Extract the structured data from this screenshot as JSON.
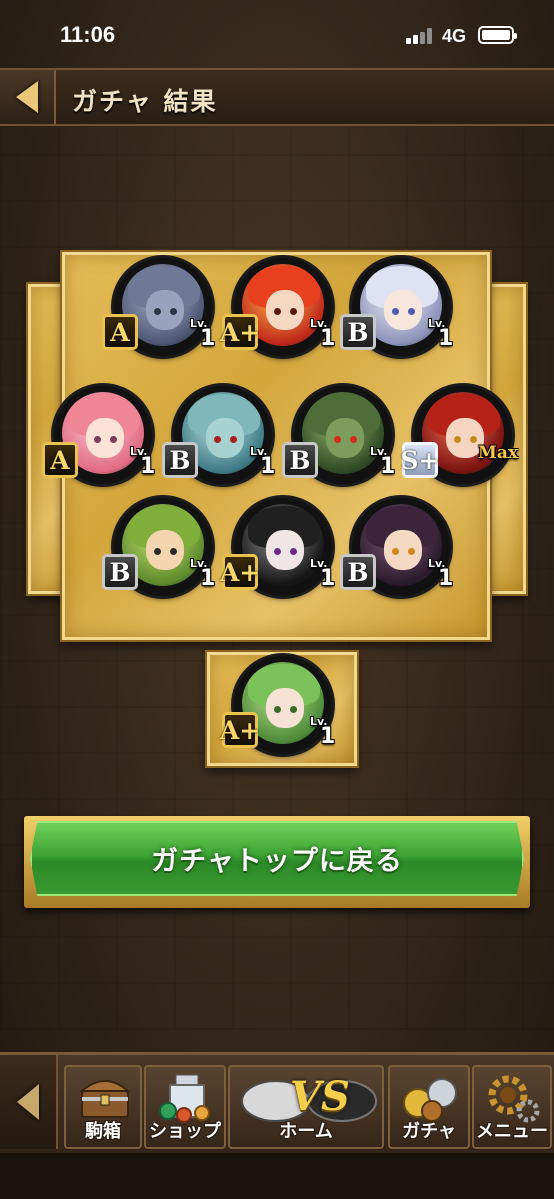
{
  "status_bar": {
    "time": "11:06",
    "network": "4G"
  },
  "header": {
    "title": "ガチャ 結果"
  },
  "results": [
    {
      "rank": "A",
      "rank_style": "gold",
      "lv_label": "Lv.",
      "level": "1",
      "c1": "#a7b0c8",
      "c2": "#4c5572",
      "hair": "#6f7894",
      "face": "#9aa3bd",
      "eye": "#2e3448",
      "ring": "#9b36d8"
    },
    {
      "rank": "A+",
      "rank_style": "gold",
      "lv_label": "Lv.",
      "level": "1",
      "c1": "#ffb14a",
      "c2": "#c0281a",
      "hair": "#e8401f",
      "face": "#f6d8c2",
      "eye": "#5a1a10",
      "ring": "#9b36d8"
    },
    {
      "rank": "B",
      "rank_style": "silver",
      "lv_label": "Lv.",
      "level": "1",
      "c1": "#f0f2fb",
      "c2": "#8b91b8",
      "hair": "#dfe2f2",
      "face": "#f7e6dc",
      "eye": "#4a5bb0",
      "ring": "#e8d02a"
    },
    {
      "rank": "A",
      "rank_style": "gold",
      "lv_label": "Lv.",
      "level": "1",
      "c1": "#ffc2d1",
      "c2": "#e06b82",
      "hair": "#f08596",
      "face": "#fbe1d6",
      "eye": "#7a3d58",
      "ring": "#e8d02a"
    },
    {
      "rank": "B",
      "rank_style": "silver",
      "lv_label": "Lv.",
      "level": "1",
      "c1": "#b9e0e0",
      "c2": "#3e7a86",
      "hair": "#7fb7bb",
      "face": "#a6d3d2",
      "eye": "#a82020",
      "ring": "#9b36d8"
    },
    {
      "rank": "B",
      "rank_style": "silver",
      "lv_label": "Lv.",
      "level": "1",
      "c1": "#8fb26b",
      "c2": "#2f4a24",
      "hair": "#4f6d38",
      "face": "#7c9d5b",
      "eye": "#d62b1c",
      "ring": "#d62b2b"
    },
    {
      "rank": "S+",
      "rank_style": "splus",
      "lv_label": "",
      "level": "Max",
      "c1": "#f06a55",
      "c2": "#7a1310",
      "hair": "#b72218",
      "face": "#f5d5c1",
      "eye": "#c48a1c",
      "ring": "#f0c23a"
    },
    {
      "rank": "B",
      "rank_style": "silver",
      "lv_label": "Lv.",
      "level": "1",
      "c1": "#c6e26f",
      "c2": "#5d8a2c",
      "hair": "#7fae3a",
      "face": "#f3d6b0",
      "eye": "#2a2a2a",
      "ring": "#e8d02a"
    },
    {
      "rank": "A+",
      "rank_style": "gold",
      "lv_label": "Lv.",
      "level": "1",
      "c1": "#8e8e8e",
      "c2": "#161616",
      "hair": "#202020",
      "face": "#f1e6e6",
      "eye": "#6c2c8a",
      "ring": "#9b36d8"
    },
    {
      "rank": "B",
      "rank_style": "silver",
      "lv_label": "Lv.",
      "level": "1",
      "c1": "#7d5a7a",
      "c2": "#2b1a2b",
      "hair": "#3c243b",
      "face": "#f4d9c4",
      "eye": "#d28a1c",
      "ring": "#9b36d8"
    }
  ],
  "bonus": {
    "rank": "A+",
    "rank_style": "gold",
    "lv_label": "Lv.",
    "level": "1",
    "c1": "#b6e28a",
    "c2": "#4e8a3a",
    "hair": "#7cc25a",
    "face": "#f6e3d6",
    "eye": "#3e6a2c",
    "ring": "#9b36d8"
  },
  "return_button": {
    "label": "ガチャトップに戻る"
  },
  "nav": {
    "box": "駒箱",
    "shop": "ショップ",
    "home": "ホーム",
    "home_vs": "VS",
    "gacha": "ガチャ",
    "menu": "メニュー"
  }
}
